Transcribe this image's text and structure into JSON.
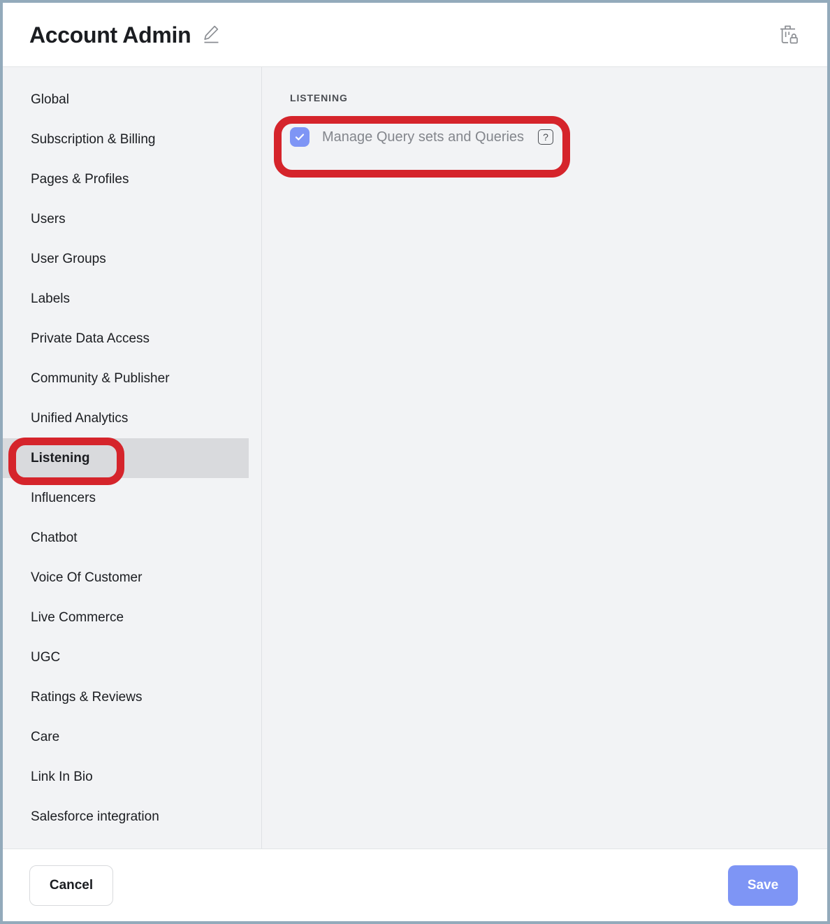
{
  "header": {
    "title": "Account Admin",
    "edit_icon": "pencil-edit-icon",
    "delete_icon": "trash-lock-icon"
  },
  "sidebar": {
    "items": [
      {
        "label": "Global",
        "active": false
      },
      {
        "label": "Subscription & Billing",
        "active": false
      },
      {
        "label": "Pages & Profiles",
        "active": false
      },
      {
        "label": "Users",
        "active": false
      },
      {
        "label": "User Groups",
        "active": false
      },
      {
        "label": "Labels",
        "active": false
      },
      {
        "label": "Private Data Access",
        "active": false
      },
      {
        "label": "Community & Publisher",
        "active": false
      },
      {
        "label": "Unified Analytics",
        "active": false
      },
      {
        "label": "Listening",
        "active": true
      },
      {
        "label": "Influencers",
        "active": false
      },
      {
        "label": "Chatbot",
        "active": false
      },
      {
        "label": "Voice Of Customer",
        "active": false
      },
      {
        "label": "Live Commerce",
        "active": false
      },
      {
        "label": "UGC",
        "active": false
      },
      {
        "label": "Ratings & Reviews",
        "active": false
      },
      {
        "label": "Care",
        "active": false
      },
      {
        "label": "Link In Bio",
        "active": false
      },
      {
        "label": "Salesforce integration",
        "active": false
      }
    ]
  },
  "main": {
    "section_label": "LISTENING",
    "permissions": [
      {
        "label": "Manage Query sets and Queries",
        "checked": true,
        "help_icon": "question-mark-icon",
        "help_glyph": "?"
      }
    ]
  },
  "footer": {
    "cancel_label": "Cancel",
    "save_label": "Save"
  },
  "colors": {
    "accent_blue": "#7e95f5",
    "annotation_red": "#d5242b",
    "panel_bg": "#f2f3f5",
    "active_nav_bg": "#d9dadd",
    "window_border": "#93aabb",
    "muted_text": "#83868c"
  },
  "annotations": [
    {
      "name": "highlight-permission-row",
      "target": "Manage Query sets and Queries"
    },
    {
      "name": "highlight-sidebar-listening",
      "target": "Listening"
    }
  ]
}
